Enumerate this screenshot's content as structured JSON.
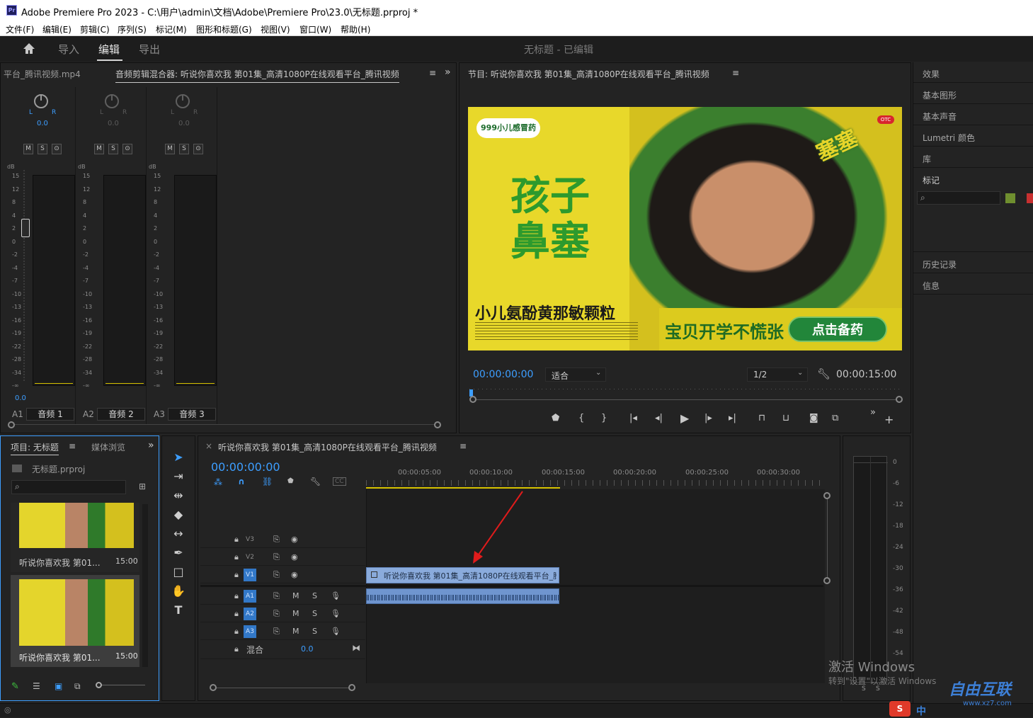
{
  "window": {
    "title": "Adobe Premiere Pro 2023 - C:\\用户\\admin\\文档\\Adobe\\Premiere Pro\\23.0\\无标题.prproj *",
    "app_icon": "Pr"
  },
  "menu": [
    "文件(F)",
    "编辑(E)",
    "剪辑(C)",
    "序列(S)",
    "标记(M)",
    "图形和标题(G)",
    "视图(V)",
    "窗口(W)",
    "帮助(H)"
  ],
  "workspace": {
    "tabs": [
      "导入",
      "编辑",
      "导出"
    ],
    "active": "编辑",
    "project_status": "无标题 - 已编辑"
  },
  "mixer": {
    "source_tab": "平台_腾讯视频.mp4",
    "title": "音频剪辑混合器: 听说你喜欢我 第01集_高清1080P在线观看平台_腾讯视频",
    "lr": "L",
    "lr_r": "R",
    "db_label": "dB",
    "scale": [
      "15",
      "12",
      "8",
      "4",
      "2",
      "0",
      "-2",
      "-4",
      "-7",
      "-10",
      "-13",
      "-16",
      "-19",
      "-22",
      "-28",
      "-34",
      "-∞"
    ],
    "msr": [
      "M",
      "S",
      "⊙"
    ],
    "fader_value": "0.0",
    "channels": [
      {
        "id": "A1",
        "name": "音频 1",
        "pan": "0.0"
      },
      {
        "id": "A2",
        "name": "音频 2",
        "pan": "0.0"
      },
      {
        "id": "A3",
        "name": "音频 3",
        "pan": "0.0"
      }
    ]
  },
  "program": {
    "title": "节目: 听说你喜欢我 第01集_高清1080P在线观看平台_腾讯视频",
    "timecode": "00:00:00:00",
    "fit": "适合",
    "resolution": "1/2",
    "duration": "00:00:15:00",
    "ad": {
      "brand": "999小儿感冒药",
      "headline_1": "孩子",
      "headline_2": "鼻塞",
      "product": "小儿氨酚黄那敏颗粒",
      "tagline": "宝贝开学不慌张",
      "cta": "点击备药",
      "badge": "OTC",
      "sticker": "塞塞"
    }
  },
  "right_panel": {
    "items": [
      "效果",
      "基本图形",
      "基本声音",
      "Lumetri 颜色",
      "库",
      "标记",
      "历史记录",
      "信息"
    ],
    "marker_colors": [
      "#6f8f2f",
      "#c83030"
    ]
  },
  "project": {
    "tabs": [
      "项目: 无标题",
      "媒体浏览"
    ],
    "file": "无标题.prproj",
    "items": [
      {
        "name": "听说你喜欢我 第01...",
        "duration": "15:00"
      },
      {
        "name": "听说你喜欢我 第01...",
        "duration": "15:00"
      }
    ]
  },
  "timeline": {
    "title": "听说你喜欢我 第01集_高清1080P在线观看平台_腾讯视频",
    "timecode": "00:00:00:00",
    "ruler": [
      "00:00:05:00",
      "00:00:10:00",
      "00:00:15:00",
      "00:00:20:00",
      "00:00:25:00",
      "00:00:30:00"
    ],
    "video_tracks": [
      "V3",
      "V2",
      "V1"
    ],
    "audio_tracks": [
      "A1",
      "A2",
      "A3"
    ],
    "mix_label": "混合",
    "mix_value": "0.0",
    "m_label": "M",
    "s_label": "S",
    "clip_label": "听说你喜欢我 第01集_高清1080P在线观看平台_腾讯",
    "cc": "CC"
  },
  "vu_scale": [
    "0",
    "-6",
    "-12",
    "-18",
    "-24",
    "-30",
    "-36",
    "-42",
    "-48",
    "-54"
  ],
  "vu_ss": [
    "S",
    "S"
  ],
  "overlay": {
    "activate": "激活 Windows",
    "activate_sub": "转到\"设置\"以激活 Windows",
    "watermark": "自由互联",
    "watermark_url": "www.xz7.com",
    "ime": "中"
  }
}
